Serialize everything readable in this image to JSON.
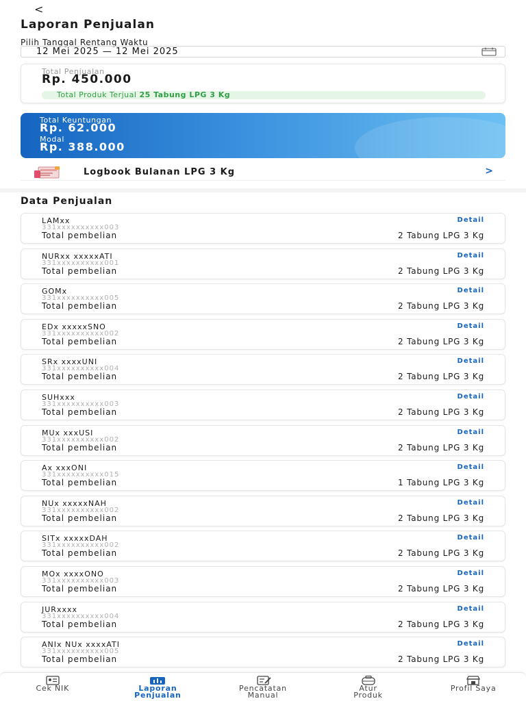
{
  "header": {
    "back": "<",
    "title": "Laporan Penjualan"
  },
  "date_range": {
    "label": "Pilih Tanggal Rentang Waktu",
    "value": "12 Mei 2025 — 12 Mei 2025"
  },
  "summary": {
    "total_label": "Total Penjualan",
    "total_value": "Rp. 450.000",
    "sold_prefix": "Total Produk Terjual",
    "sold_value": "25 Tabung LPG 3 Kg"
  },
  "profit": {
    "profit_label": "Total Keuntungan",
    "profit_value": "Rp. 62.000",
    "capital_label": "Modal",
    "capital_value": "Rp. 388.000"
  },
  "logbook": {
    "label": "Logbook Bulanan LPG 3 Kg",
    "chevron": ">"
  },
  "sales": {
    "title": "Data Penjualan",
    "detail_label": "Detail",
    "purchase_label": "Total pembelian",
    "rows": [
      {
        "name": "LAMxx",
        "nik": "331xxxxxxxxxx003",
        "qty": "2 Tabung LPG 3 Kg"
      },
      {
        "name": "NURxx xxxxxATI",
        "nik": "331xxxxxxxxxx001",
        "qty": "2 Tabung LPG 3 Kg"
      },
      {
        "name": "GOMx",
        "nik": "331xxxxxxxxxx005",
        "qty": "2 Tabung LPG 3 Kg"
      },
      {
        "name": "EDx xxxxxSNO",
        "nik": "331xxxxxxxxxx002",
        "qty": "2 Tabung LPG 3 Kg"
      },
      {
        "name": "SRx xxxxUNI",
        "nik": "331xxxxxxxxxx004",
        "qty": "2 Tabung LPG 3 Kg"
      },
      {
        "name": "SUHxxx",
        "nik": "331xxxxxxxxxx003",
        "qty": "2 Tabung LPG 3 Kg"
      },
      {
        "name": "MUx xxxUSI",
        "nik": "331xxxxxxxxxx002",
        "qty": "2 Tabung LPG 3 Kg"
      },
      {
        "name": "Ax xxxONI",
        "nik": "331xxxxxxxxxx015",
        "qty": "1 Tabung LPG 3 Kg"
      },
      {
        "name": "NUx xxxxxNAH",
        "nik": "331xxxxxxxxxx002",
        "qty": "2 Tabung LPG 3 Kg"
      },
      {
        "name": "SITx xxxxxDAH",
        "nik": "331xxxxxxxxxx002",
        "qty": "2 Tabung LPG 3 Kg"
      },
      {
        "name": "MOx xxxxONO",
        "nik": "331xxxxxxxxxx003",
        "qty": "2 Tabung LPG 3 Kg"
      },
      {
        "name": "JURxxxx",
        "nik": "331xxxxxxxxxx004",
        "qty": "2 Tabung LPG 3 Kg"
      },
      {
        "name": "ANIx NUx xxxxATI",
        "nik": "331xxxxxxxxxx005",
        "qty": "2 Tabung LPG 3 Kg"
      }
    ]
  },
  "nav": {
    "items": [
      {
        "line1": "Cek NIK",
        "line2": "",
        "icon": "id-card-icon"
      },
      {
        "line1": "Laporan",
        "line2": "Penjualan",
        "icon": "report-icon"
      },
      {
        "line1": "Pencatatan",
        "line2": "Manual",
        "icon": "notes-icon"
      },
      {
        "line1": "Atur",
        "line2": "Produk",
        "icon": "gas-cylinder-icon"
      },
      {
        "line1": "Profil Saya",
        "line2": "",
        "icon": "shop-icon"
      }
    ],
    "active_index": 1
  },
  "colors": {
    "accent": "#1565c0",
    "success": "#2f9e44",
    "success_bg": "#e6f6e6"
  }
}
